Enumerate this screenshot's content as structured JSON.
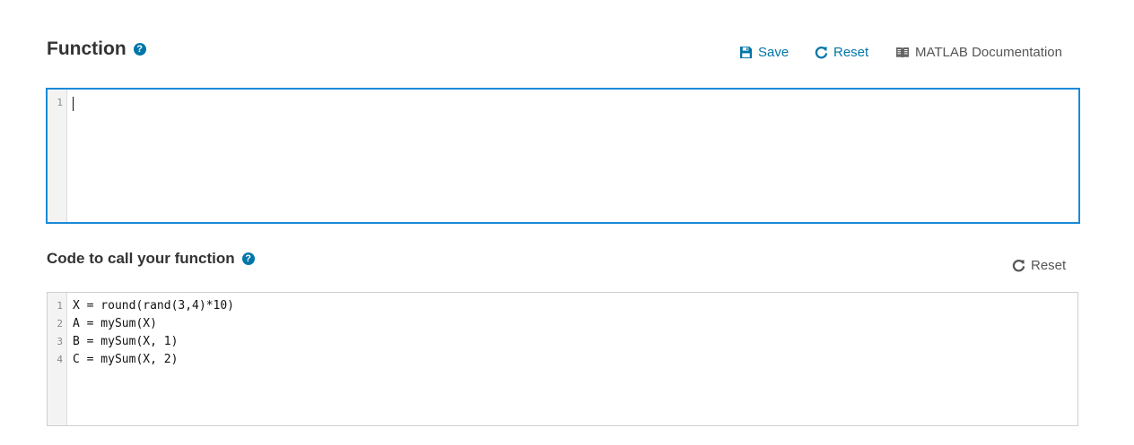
{
  "function_section": {
    "title": "Function",
    "help_icon": "question-circle-icon",
    "toolbar": {
      "save_label": "Save",
      "save_icon": "floppy-disk-icon",
      "reset_label": "Reset",
      "reset_icon": "refresh-icon",
      "docs_label": "MATLAB Documentation",
      "docs_icon": "book-icon"
    },
    "editor": {
      "line_numbers": [
        "1"
      ],
      "lines": [
        ""
      ]
    }
  },
  "call_section": {
    "title": "Code to call your function",
    "help_icon": "question-circle-icon",
    "reset_label": "Reset",
    "reset_icon": "refresh-icon",
    "editor": {
      "line_numbers": [
        "1",
        "2",
        "3",
        "4"
      ],
      "lines": [
        "X = round(rand(3,4)*10)",
        "A = mySum(X)",
        "B = mySum(X, 1)",
        "C = mySum(X, 2)"
      ]
    }
  },
  "colors": {
    "accent": "#0076a8",
    "focus_border": "#1a8ad8",
    "muted_text": "#555555"
  }
}
